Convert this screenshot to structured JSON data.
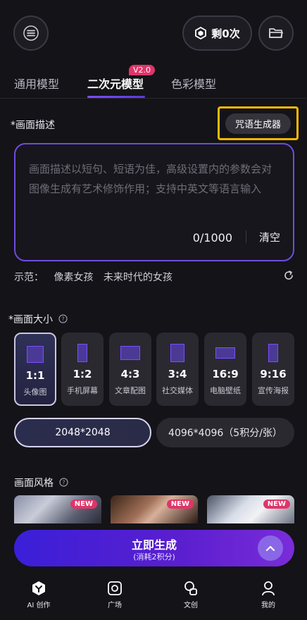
{
  "header": {
    "credits_label": "剩0次"
  },
  "tabs": [
    {
      "label": "通用模型"
    },
    {
      "label": "二次元模型",
      "badge": "V2.0"
    },
    {
      "label": "色彩模型"
    }
  ],
  "prompt": {
    "section_title": "*画面描述",
    "spell_button": "咒语生成器",
    "placeholder": "画面描述以短句、短语为佳，高级设置内的参数会对图像生成有艺术修饰作用；支持中英文等语言输入",
    "counter": "0/1000",
    "clear_label": "清空",
    "examples_label": "示范：",
    "examples": [
      "像素女孩",
      "未来时代的女孩"
    ]
  },
  "size": {
    "section_title": "*画面大小",
    "options": [
      {
        "ratio": "1:1",
        "label": "头像图",
        "selected": true
      },
      {
        "ratio": "1:2",
        "label": "手机屏幕",
        "selected": false
      },
      {
        "ratio": "4:3",
        "label": "文章配图",
        "selected": false
      },
      {
        "ratio": "3:4",
        "label": "社交媒体",
        "selected": false
      },
      {
        "ratio": "16:9",
        "label": "电脑壁纸",
        "selected": false
      },
      {
        "ratio": "9:16",
        "label": "宣传海报",
        "selected": false
      }
    ],
    "resolutions": [
      {
        "label": "2048*2048",
        "selected": true
      },
      {
        "label": "4096*4096（5积分/张）",
        "selected": false
      }
    ]
  },
  "style": {
    "section_title": "画面风格",
    "thumbs": [
      {
        "badge": "NEW"
      },
      {
        "badge": "NEW"
      },
      {
        "badge": "NEW"
      }
    ]
  },
  "generate": {
    "title": "立即生成",
    "subtitle": "(消耗2积分)"
  },
  "nav": [
    {
      "label": "AI 创作",
      "icon": "ai-create-icon"
    },
    {
      "label": "广场",
      "icon": "square-icon"
    },
    {
      "label": "文创",
      "icon": "creative-icon"
    },
    {
      "label": "我的",
      "icon": "profile-icon"
    }
  ],
  "colors": {
    "background": "#141318",
    "accent": "#6e4ce0",
    "highlight": "#f5b800",
    "badge": "#e0356a"
  }
}
